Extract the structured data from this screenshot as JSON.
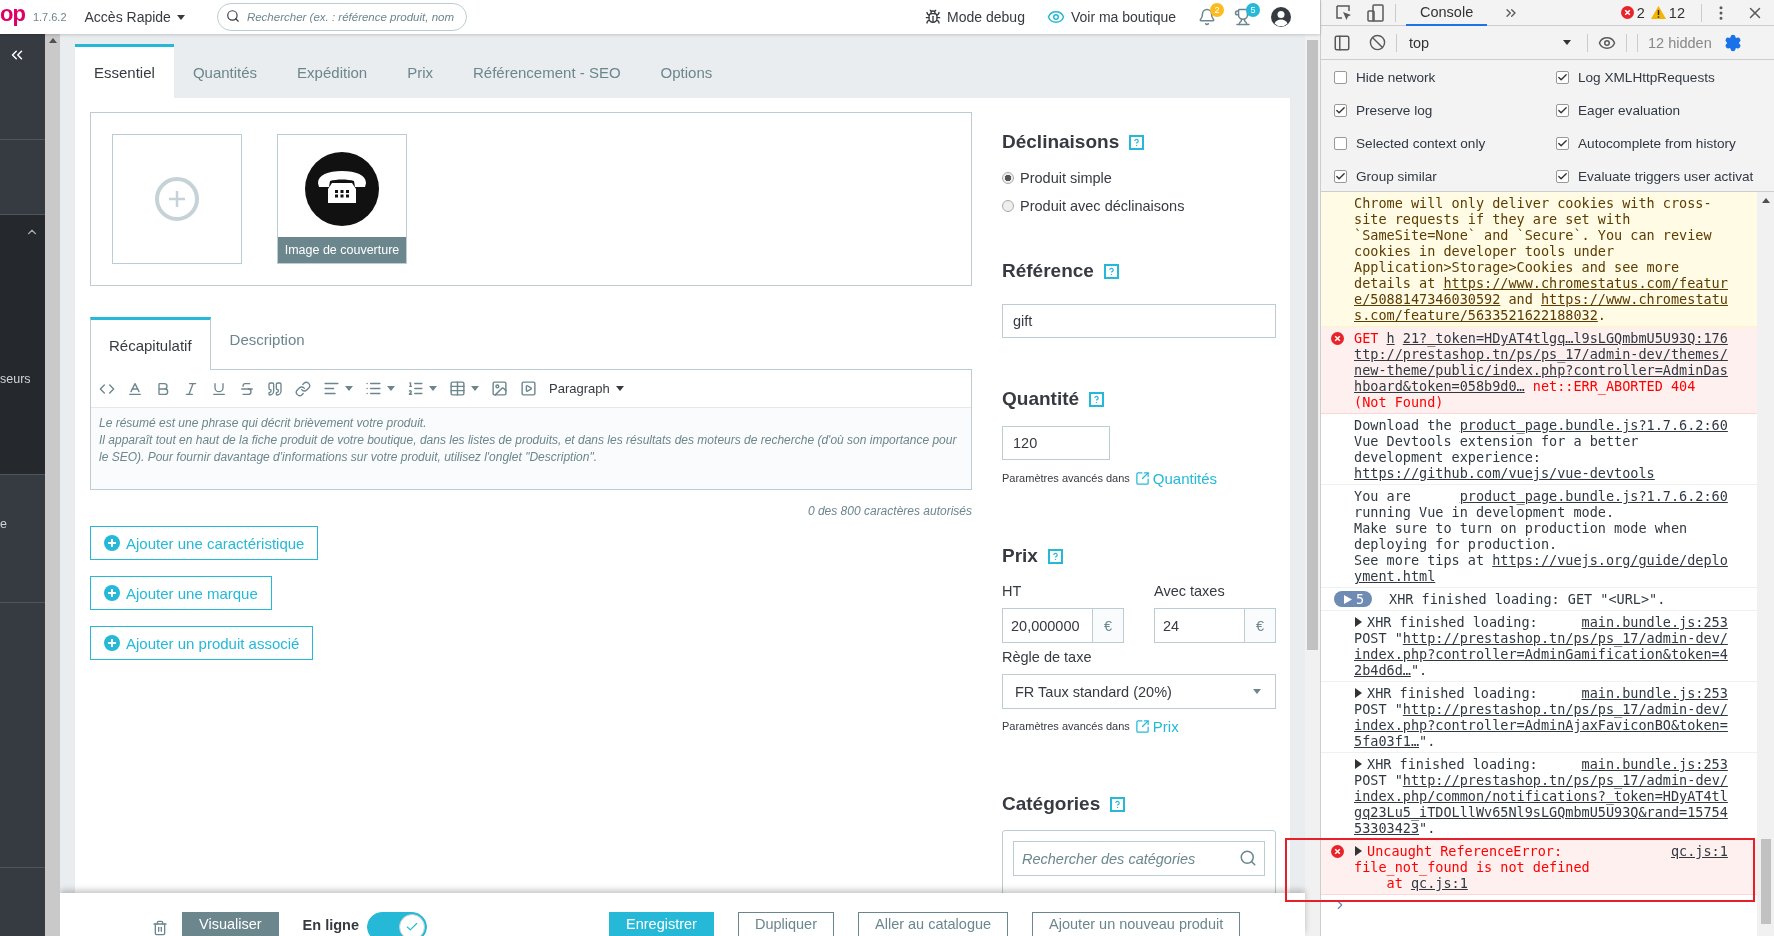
{
  "header": {
    "logo": "op",
    "version": "1.7.6.2",
    "quick_access": "Accès Rapide",
    "search": {
      "placeholder": "Rechercher (ex. : référence produit, nom"
    },
    "actions": [
      {
        "kind": "debug",
        "label": "Mode debug"
      },
      {
        "kind": "shop",
        "label": "Voir ma boutique"
      }
    ],
    "notifications": [
      {
        "kind": "bell",
        "count": "2",
        "color": "#fbbb22"
      },
      {
        "kind": "trophy",
        "count": "5",
        "color": "#25b9d7"
      }
    ]
  },
  "sidebar": {
    "items": [
      {
        "label": "seurs"
      },
      {
        "label": "e"
      }
    ]
  },
  "product_tabs": [
    {
      "label": "Essentiel",
      "selected": true
    },
    {
      "label": "Quantités",
      "selected": false
    },
    {
      "label": "Expédition",
      "selected": false
    },
    {
      "label": "Prix",
      "selected": false
    },
    {
      "label": "Référencement - SEO",
      "selected": false
    },
    {
      "label": "Options",
      "selected": false
    }
  ],
  "images": {
    "cover_label": "Image de couverture"
  },
  "description_tabs": [
    {
      "label": "Récapitulatif",
      "selected": true
    },
    {
      "label": "Description",
      "selected": false
    }
  ],
  "editor": {
    "format": "Paragraph",
    "placeholder": [
      "Le résumé est une phrase qui décrit brièvement votre produit.",
      "Il apparaît tout en haut de la fiche produit de votre boutique, dans les listes de produits, et dans les résultats des moteurs de recherche (d'où son importance pour le SEO). Pour fournir davantage d'informations sur votre produit, utilisez l'onglet \"Description\"."
    ],
    "counter": "0 des 800 caractères autorisés"
  },
  "add_buttons": [
    "Ajouter une caractéristique",
    "Ajouter une marque",
    "Ajouter un produit associé"
  ],
  "declinaisons": {
    "title": "Déclinaisons",
    "options": [
      {
        "label": "Produit simple",
        "selected": true
      },
      {
        "label": "Produit avec déclinaisons",
        "selected": false
      }
    ]
  },
  "reference": {
    "title": "Référence",
    "value": "gift"
  },
  "quantity": {
    "title": "Quantité",
    "value": "120",
    "advanced_label": "Paramètres avancés dans",
    "advanced_link": "Quantités"
  },
  "price": {
    "title": "Prix",
    "fields": [
      {
        "label": "HT",
        "value": "20,000000",
        "currency": "€"
      },
      {
        "label": "Avec taxes",
        "value": "24",
        "currency": "€"
      }
    ],
    "tax_label": "Règle de taxe",
    "tax_value": "FR Taux standard (20%)",
    "advanced_label": "Paramètres avancés dans",
    "advanced_link": "Prix"
  },
  "categories": {
    "title": "Catégories",
    "search_placeholder": "Rechercher des catégories"
  },
  "footer": {
    "preview": "Visualiser",
    "online_label": "En ligne",
    "online": true,
    "buttons": [
      {
        "label": "Enregistrer",
        "kind": "primary"
      },
      {
        "label": "Dupliquer",
        "kind": "outline"
      },
      {
        "label": "Aller au catalogue",
        "kind": "outline"
      },
      {
        "label": "Ajouter un nouveau produit",
        "kind": "outline"
      }
    ]
  },
  "devtools": {
    "tabs": [
      {
        "label": "Console",
        "selected": true
      }
    ],
    "error_count": "2",
    "warning_count": "12",
    "context": "top",
    "hidden": "12 hidden",
    "settings": [
      {
        "label": "Hide network",
        "checked": false
      },
      {
        "label": "Log XMLHttpRequests",
        "checked": true
      },
      {
        "label": "Preserve log",
        "checked": true
      },
      {
        "label": "Eager evaluation",
        "checked": true
      },
      {
        "label": "Selected context only",
        "checked": false
      },
      {
        "label": "Autocomplete from history",
        "checked": true
      },
      {
        "label": "Group similar",
        "checked": true
      },
      {
        "label": "Evaluate triggers user activat",
        "checked": true
      }
    ],
    "messages": [
      {
        "kind": "warning",
        "expandable": false,
        "lines": [
          [
            {
              "kind": "text",
              "text": "Chrome will only deliver cookies with cross-"
            }
          ],
          [
            {
              "kind": "text",
              "text": "site requests if they are set with"
            }
          ],
          [
            {
              "kind": "text",
              "text": "`SameSite=None` and `Secure`. You can review"
            }
          ],
          [
            {
              "kind": "text",
              "text": "cookies in developer tools under"
            }
          ],
          [
            {
              "kind": "text",
              "text": "Application>Storage>Cookies and see more"
            }
          ],
          [
            {
              "kind": "text",
              "text": "details at "
            },
            {
              "kind": "link",
              "text": "https://www.chromestatus.com/featur"
            }
          ],
          [
            {
              "kind": "link",
              "text": "e/5088147346030592"
            },
            {
              "kind": "text",
              "text": " and "
            },
            {
              "kind": "link",
              "text": "https://www.chromestatu"
            }
          ],
          [
            {
              "kind": "link",
              "text": "s.com/feature/5633521622188032"
            },
            {
              "kind": "text",
              "text": "."
            }
          ]
        ]
      },
      {
        "kind": "error",
        "expandable": false,
        "source": "21?_token=HDyAT4tlgq…l9sLGQmbmU5U93Q:176",
        "lines": [
          [
            {
              "kind": "text",
              "text": "GET "
            },
            {
              "kind": "link",
              "text": "h"
            }
          ],
          [
            {
              "kind": "link",
              "text": "ttp://prestashop.tn/ps/ps_17/admin-dev/themes/"
            }
          ],
          [
            {
              "kind": "link",
              "text": "new-theme/public/index.php?controller=AdminDas"
            }
          ],
          [
            {
              "kind": "link",
              "text": "hboard&token=058b9d0…"
            },
            {
              "kind": "text",
              "text": " net::ERR_ABORTED 404"
            }
          ],
          [
            {
              "kind": "text",
              "text": "(Not Found)"
            }
          ]
        ]
      },
      {
        "kind": "info",
        "expandable": false,
        "source": "product_page.bundle.js?1.7.6.2:60",
        "lines": [
          [
            {
              "kind": "text",
              "text": "Download the"
            }
          ],
          [
            {
              "kind": "text",
              "text": "Vue Devtools extension for a better"
            }
          ],
          [
            {
              "kind": "text",
              "text": "development experience:"
            }
          ],
          [
            {
              "kind": "link",
              "text": "https://github.com/vuejs/vue-devtools"
            }
          ]
        ]
      },
      {
        "kind": "info",
        "expandable": false,
        "source": "product_page.bundle.js?1.7.6.2:60",
        "lines": [
          [
            {
              "kind": "text",
              "text": "You are"
            }
          ],
          [
            {
              "kind": "text",
              "text": "running Vue in development mode."
            }
          ],
          [
            {
              "kind": "text",
              "text": "Make sure to turn on production mode when"
            }
          ],
          [
            {
              "kind": "text",
              "text": "deploying for production."
            }
          ],
          [
            {
              "kind": "text",
              "text": "See more tips at "
            },
            {
              "kind": "link",
              "text": "https://vuejs.org/guide/deplo"
            }
          ],
          [
            {
              "kind": "link",
              "text": "yment.html"
            }
          ]
        ]
      },
      {
        "kind": "group",
        "expandable": false,
        "count": "5",
        "lines": [
          [
            {
              "kind": "text",
              "text": "XHR finished loading: GET \"<URL>\"."
            }
          ]
        ]
      },
      {
        "kind": "info",
        "expandable": true,
        "source": "main.bundle.js:253",
        "lines": [
          [
            {
              "kind": "text",
              "text": "XHR finished loading:"
            }
          ],
          [
            {
              "kind": "text",
              "text": "POST \""
            },
            {
              "kind": "link",
              "text": "http://prestashop.tn/ps/ps_17/admin-dev/"
            }
          ],
          [
            {
              "kind": "link",
              "text": "index.php?controller=AdminGamification&token=4"
            }
          ],
          [
            {
              "kind": "link",
              "text": "2b4d6d…"
            },
            {
              "kind": "text",
              "text": "\"."
            }
          ]
        ]
      },
      {
        "kind": "info",
        "expandable": true,
        "source": "main.bundle.js:253",
        "lines": [
          [
            {
              "kind": "text",
              "text": "XHR finished loading:"
            }
          ],
          [
            {
              "kind": "text",
              "text": "POST \""
            },
            {
              "kind": "link",
              "text": "http://prestashop.tn/ps/ps_17/admin-dev/"
            }
          ],
          [
            {
              "kind": "link",
              "text": "index.php?controller=AdminAjaxFaviconBO&token="
            }
          ],
          [
            {
              "kind": "link",
              "text": "5fa03f1…"
            },
            {
              "kind": "text",
              "text": "\"."
            }
          ]
        ]
      },
      {
        "kind": "info",
        "expandable": true,
        "source": "main.bundle.js:253",
        "lines": [
          [
            {
              "kind": "text",
              "text": "XHR finished loading:"
            }
          ],
          [
            {
              "kind": "text",
              "text": "POST \""
            },
            {
              "kind": "link",
              "text": "http://prestashop.tn/ps/ps_17/admin-dev/"
            }
          ],
          [
            {
              "kind": "link",
              "text": "index.php/common/notifications?_token=HDyAT4tl"
            }
          ],
          [
            {
              "kind": "link",
              "text": "gq23Lu5_iTDOLllWv65Nl9sLGQmbmU5U93Q&rand=15754"
            }
          ],
          [
            {
              "kind": "link",
              "text": "53303423"
            },
            {
              "kind": "text",
              "text": "\"."
            }
          ]
        ]
      },
      {
        "kind": "error",
        "expandable": true,
        "source": "qc.js:1",
        "lines": [
          [
            {
              "kind": "text",
              "text": "Uncaught ReferenceError:"
            }
          ],
          [
            {
              "kind": "text",
              "text": "file_not_found is not defined"
            }
          ],
          [
            {
              "kind": "text",
              "text": "    at "
            },
            {
              "kind": "link",
              "text": "qc.js:1"
            }
          ]
        ]
      }
    ]
  }
}
